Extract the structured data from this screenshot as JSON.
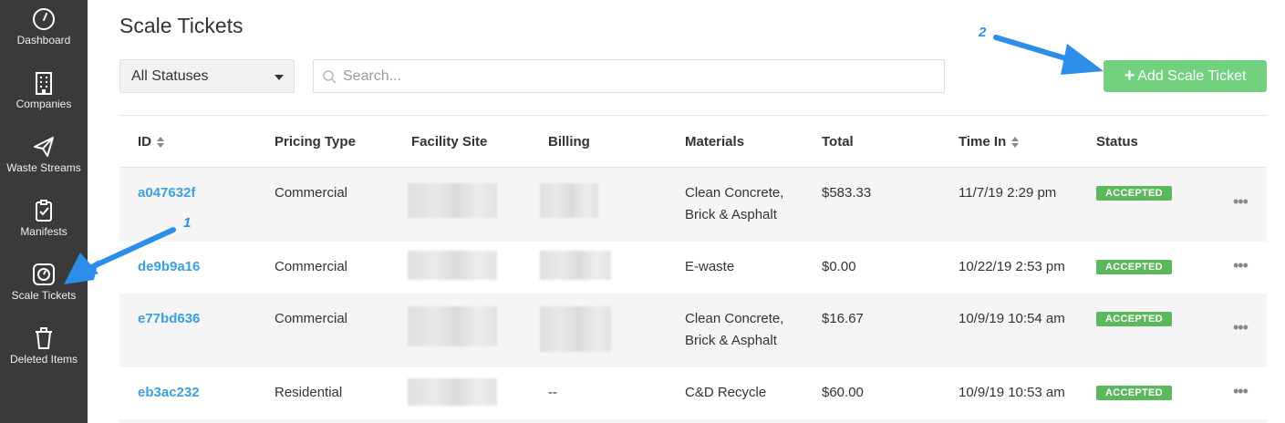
{
  "sidebar": {
    "items": [
      {
        "label": "Dashboard",
        "icon": "dashboard-gauge-icon"
      },
      {
        "label": "Companies",
        "icon": "building-icon"
      },
      {
        "label": "Waste Streams",
        "icon": "paper-plane-icon"
      },
      {
        "label": "Manifests",
        "icon": "clipboard-check-icon"
      },
      {
        "label": "Scale Tickets",
        "icon": "scale-gauge-icon"
      },
      {
        "label": "Deleted Items",
        "icon": "trash-icon"
      }
    ]
  },
  "header": {
    "title": "Scale Tickets"
  },
  "filters": {
    "status_value": "All Statuses",
    "search_placeholder": "Search...",
    "search_value": ""
  },
  "actions": {
    "add_label": "Add Scale Ticket",
    "add_color": "#72d17e"
  },
  "table": {
    "columns": [
      "ID",
      "Pricing Type",
      "Facility Site",
      "Billing",
      "Materials",
      "Total",
      "Time In",
      "Status"
    ],
    "rows": [
      {
        "id": "a047632f",
        "pricing": "Commercial",
        "billing": "",
        "materials": [
          "Clean Concrete,",
          "Brick & Asphalt"
        ],
        "total": "$583.33",
        "time_in": "11/7/19 2:29 pm",
        "status": "ACCEPTED"
      },
      {
        "id": "de9b9a16",
        "pricing": "Commercial",
        "billing": "",
        "materials": [
          "E-waste"
        ],
        "total": "$0.00",
        "time_in": "10/22/19 2:53 pm",
        "status": "ACCEPTED"
      },
      {
        "id": "e77bd636",
        "pricing": "Commercial",
        "billing": "",
        "materials": [
          "Clean Concrete,",
          "Brick & Asphalt"
        ],
        "total": "$16.67",
        "time_in": "10/9/19 10:54 am",
        "status": "ACCEPTED"
      },
      {
        "id": "eb3ac232",
        "pricing": "Residential",
        "billing": "--",
        "materials": [
          "C&D Recycle"
        ],
        "total": "$60.00",
        "time_in": "10/9/19 10:53 am",
        "status": "ACCEPTED"
      }
    ],
    "row_menu": "•••"
  },
  "annotations": {
    "step1": "1",
    "step2": "2",
    "arrow_color": "#2c8ee8"
  },
  "colors": {
    "sidebar_bg": "#3a3a3a",
    "link": "#3aa0e0",
    "badge": "#5cb85c"
  }
}
